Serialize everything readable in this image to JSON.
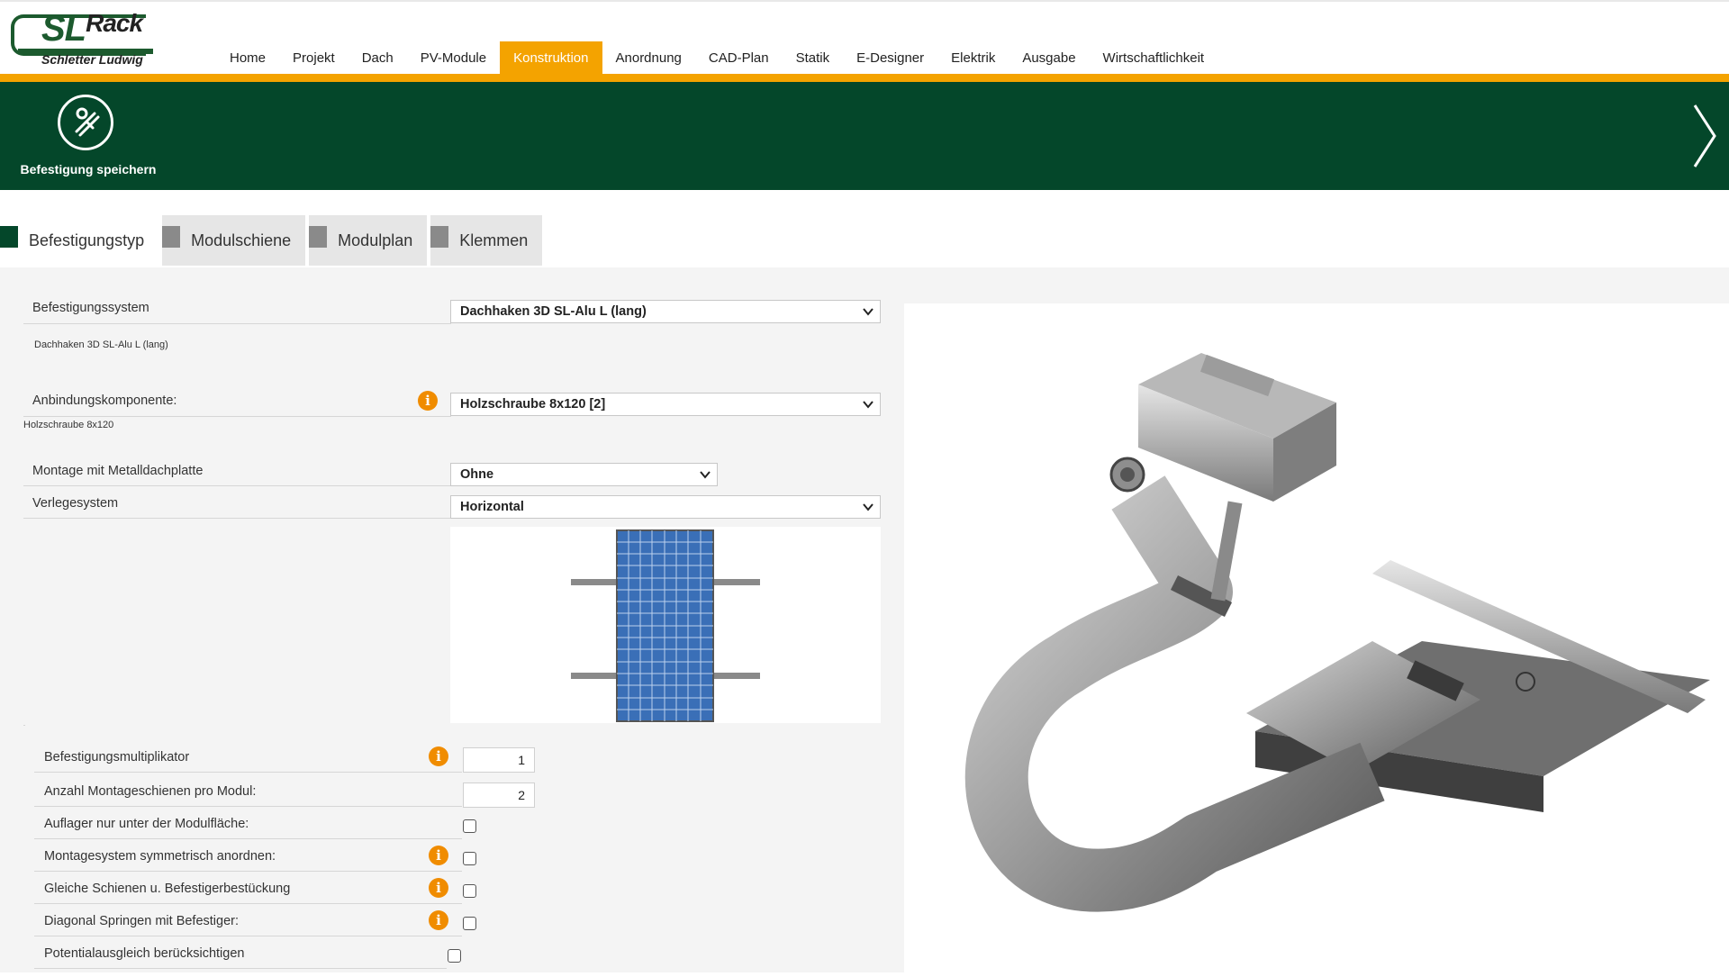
{
  "logo": {
    "brand_main": "SL",
    "brand_suffix": "Rack",
    "subtitle": "Schletter Ludwig"
  },
  "nav": {
    "items": [
      "Home",
      "Projekt",
      "Dach",
      "PV-Module",
      "Konstruktion",
      "Anordnung",
      "CAD-Plan",
      "Statik",
      "E-Designer",
      "Elektrik",
      "Ausgabe",
      "Wirtschaftlichkeit"
    ],
    "active": "Konstruktion"
  },
  "banner": {
    "save_label": "Befestigung speichern",
    "bg_color": "#04472a"
  },
  "tabs": [
    "Befestigungstyp",
    "Modulschiene",
    "Modulplan",
    "Klemmen"
  ],
  "form": {
    "befestigungssystem": {
      "label": "Befestigungssystem",
      "value": "Dachhaken 3D SL-Alu L (lang)",
      "note": "Dachhaken 3D SL-Alu L (lang)"
    },
    "anbindung": {
      "label": "Anbindungskomponente:",
      "value": "Holzschraube 8x120 [2]",
      "note": "Holzschraube 8x120"
    },
    "metalldach": {
      "label": "Montage mit Metalldachplatte",
      "value": "Ohne"
    },
    "verlegesystem": {
      "label": "Verlegesystem",
      "value": "Horizontal"
    },
    "multiplikator": {
      "label": "Befestigungsmultiplikator",
      "value": "1"
    },
    "anzahl_schienen": {
      "label": "Anzahl Montageschienen pro Modul:",
      "value": "2"
    },
    "checks": [
      {
        "label": "Auflager nur unter der Modulfläche:",
        "info": false,
        "checked": false
      },
      {
        "label": "Montagesystem symmetrisch anordnen:",
        "info": true,
        "checked": false
      },
      {
        "label": "Gleiche Schienen u. Befestigerbestückung",
        "info": true,
        "checked": false
      },
      {
        "label": "Diagonal Springen mit Befestiger:",
        "info": true,
        "checked": false
      },
      {
        "label": "Potentialausgleich berücksichtigen",
        "info": false,
        "checked": false
      }
    ]
  },
  "info_glyph": "i",
  "colors": {
    "accent": "#f4a300",
    "green": "#04472a",
    "info": "#f08c00"
  }
}
